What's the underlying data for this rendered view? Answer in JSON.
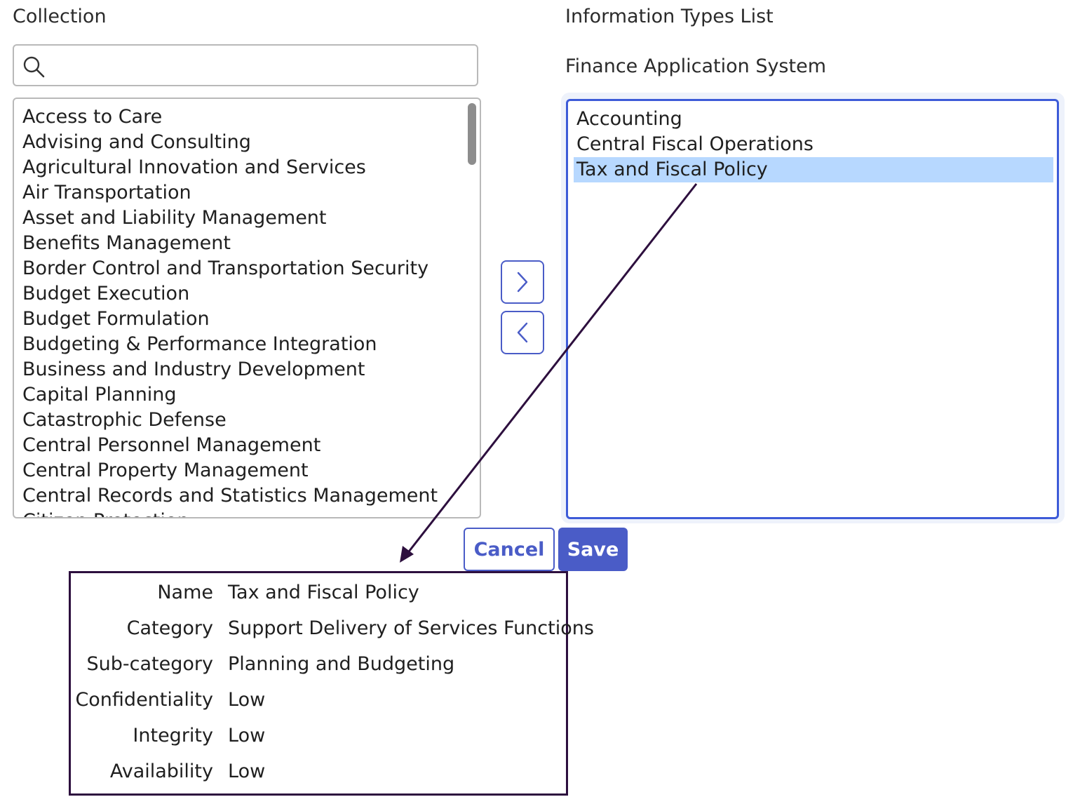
{
  "collection": {
    "heading": "Collection",
    "search": {
      "value": "",
      "placeholder": ""
    },
    "items": [
      "Access to Care",
      "Advising and Consulting",
      "Agricultural Innovation and Services",
      "Air Transportation",
      "Asset and Liability Management",
      "Benefits Management",
      "Border Control and Transportation Security",
      "Budget Execution",
      "Budget Formulation",
      "Budgeting & Performance Integration",
      "Business and Industry Development",
      "Capital Planning",
      "Catastrophic Defense",
      "Central Personnel Management",
      "Central Property Management",
      "Central Records and Statistics Management",
      "Citizen Protection"
    ]
  },
  "info_types": {
    "heading": "Information Types List",
    "system_name": "Finance Application System",
    "items": [
      "Accounting",
      "Central Fiscal Operations",
      "Tax and Fiscal Policy"
    ],
    "selected_index": 2
  },
  "controls": {
    "add_icon": "chevron-right-icon",
    "remove_icon": "chevron-left-icon"
  },
  "actions": {
    "cancel_label": "Cancel",
    "save_label": "Save"
  },
  "details": {
    "rows": [
      {
        "label": "Name",
        "value": "Tax and Fiscal Policy"
      },
      {
        "label": "Category",
        "value": "Support Delivery of Services Functions"
      },
      {
        "label": "Sub-category",
        "value": "Planning and Budgeting"
      },
      {
        "label": "Confidentiality",
        "value": "Low"
      },
      {
        "label": "Integrity",
        "value": "Low"
      },
      {
        "label": "Availability",
        "value": "Low"
      }
    ]
  },
  "colors": {
    "accent": "#4a5cc7",
    "selection": "#b7d8ff",
    "focus_border": "#3d5bd8",
    "callout_border": "#2d0f3e"
  }
}
